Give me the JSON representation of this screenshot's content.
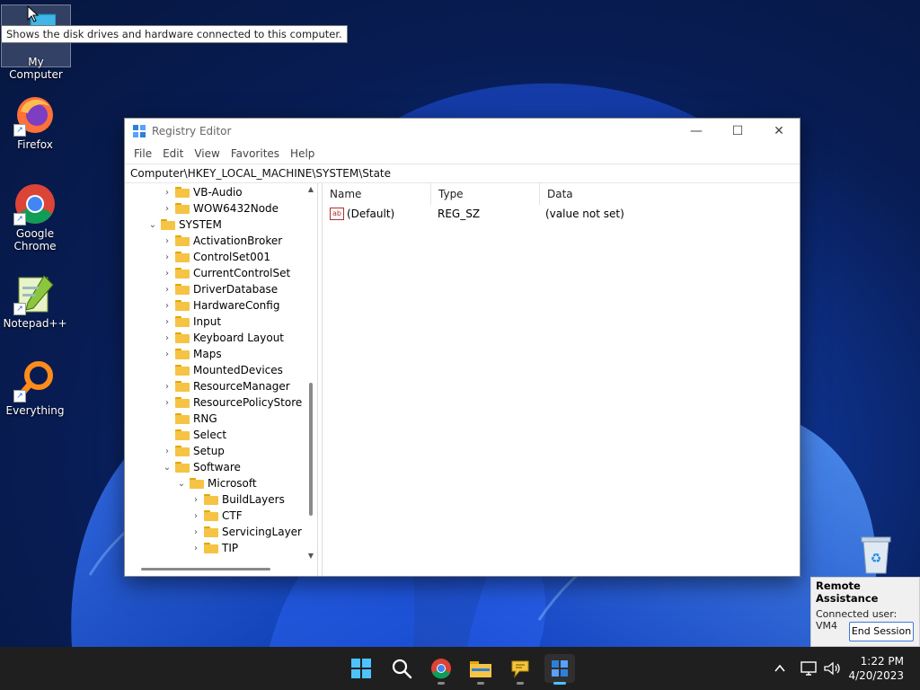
{
  "desktop": {
    "tooltip": "Shows the disk drives and hardware connected to this computer.",
    "icons": [
      {
        "label": "My Computer",
        "icon": "computer-icon"
      },
      {
        "label": "Firefox",
        "icon": "firefox-icon"
      },
      {
        "label": "Google Chrome",
        "icon": "chrome-icon"
      },
      {
        "label": "Notepad++",
        "icon": "notepadpp-icon"
      },
      {
        "label": "Everything",
        "icon": "everything-search-icon"
      }
    ]
  },
  "window": {
    "title": "Registry Editor",
    "menu": [
      "File",
      "Edit",
      "View",
      "Favorites",
      "Help"
    ],
    "address": "Computer\\HKEY_LOCAL_MACHINE\\SYSTEM\\State",
    "tree": [
      {
        "label": "VB-Audio",
        "level": 1,
        "state": "collapsed"
      },
      {
        "label": "WOW6432Node",
        "level": 1,
        "state": "collapsed"
      },
      {
        "label": "SYSTEM",
        "level": 0,
        "state": "expanded"
      },
      {
        "label": "ActivationBroker",
        "level": 1,
        "state": "collapsed"
      },
      {
        "label": "ControlSet001",
        "level": 1,
        "state": "collapsed"
      },
      {
        "label": "CurrentControlSet",
        "level": 1,
        "state": "collapsed"
      },
      {
        "label": "DriverDatabase",
        "level": 1,
        "state": "collapsed"
      },
      {
        "label": "HardwareConfig",
        "level": 1,
        "state": "collapsed"
      },
      {
        "label": "Input",
        "level": 1,
        "state": "collapsed"
      },
      {
        "label": "Keyboard Layout",
        "level": 1,
        "state": "collapsed"
      },
      {
        "label": "Maps",
        "level": 1,
        "state": "collapsed"
      },
      {
        "label": "MountedDevices",
        "level": 1,
        "state": "leaf"
      },
      {
        "label": "ResourceManager",
        "level": 1,
        "state": "collapsed"
      },
      {
        "label": "ResourcePolicyStore",
        "level": 1,
        "state": "collapsed"
      },
      {
        "label": "RNG",
        "level": 1,
        "state": "leaf"
      },
      {
        "label": "Select",
        "level": 1,
        "state": "leaf"
      },
      {
        "label": "Setup",
        "level": 1,
        "state": "collapsed"
      },
      {
        "label": "Software",
        "level": 1,
        "state": "expanded"
      },
      {
        "label": "Microsoft",
        "level": 2,
        "state": "expanded"
      },
      {
        "label": "BuildLayers",
        "level": 3,
        "state": "collapsed"
      },
      {
        "label": "CTF",
        "level": 3,
        "state": "collapsed"
      },
      {
        "label": "ServicingLayer",
        "level": 3,
        "state": "collapsed"
      },
      {
        "label": "TIP",
        "level": 3,
        "state": "collapsed"
      }
    ],
    "columns": [
      "Name",
      "Type",
      "Data"
    ],
    "values": [
      {
        "name": "(Default)",
        "type": "REG_SZ",
        "data": "(value not set)"
      }
    ]
  },
  "remote_assistance": {
    "title": "Remote Assistance",
    "status": "Connected user: VM4",
    "button": "End Session"
  },
  "taskbar": {
    "apps": [
      "windows-start-icon",
      "search-icon",
      "chrome-icon",
      "file-explorer-icon",
      "chat-bubble-icon",
      "registry-editor-icon"
    ],
    "active_app": "registry-editor-icon"
  },
  "clock": {
    "time": "1:22 PM",
    "date": "4/20/2023"
  },
  "colors": {
    "accent": "#4cc2ff",
    "folder": "#f6c445",
    "taskbar": "#1f1f1f"
  }
}
